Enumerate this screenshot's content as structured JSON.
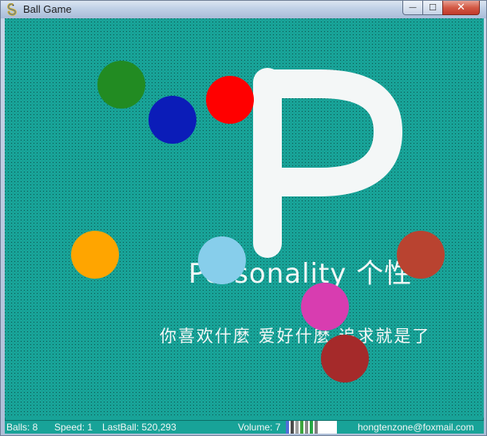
{
  "window": {
    "title": "Ball Game",
    "icon": "snake-icon",
    "minimize_label": "—",
    "maximize_label": "☐",
    "close_label": "✕"
  },
  "background": {
    "logo_letter": "P",
    "tagline_en": "Personality 个性",
    "tagline_cn": "你喜欢什麼   爱好什麼   追求就是了",
    "bg_color": "#18a398"
  },
  "balls": [
    {
      "color": "#228b22"
    },
    {
      "color": "#0b1cb8"
    },
    {
      "color": "#ff0000"
    },
    {
      "color": "#ffa500"
    },
    {
      "color": "#87ceeb"
    },
    {
      "color": "#b94330"
    },
    {
      "color": "#d83db0"
    },
    {
      "color": "#a52a2a"
    }
  ],
  "statusbar": {
    "balls": "Balls: 8",
    "speed": "Speed: 1",
    "last_ball": "LastBall: 520,293",
    "volume": "Volume: 7",
    "volume_level": 7,
    "volume_colors": [
      "#4f6fd8",
      "#4c4c4c",
      "#9e9e9e",
      "#3da63d",
      "#8a8a8a",
      "#25a845",
      "#7e7e7e"
    ],
    "email": "hongtenzone@foxmail.com"
  }
}
